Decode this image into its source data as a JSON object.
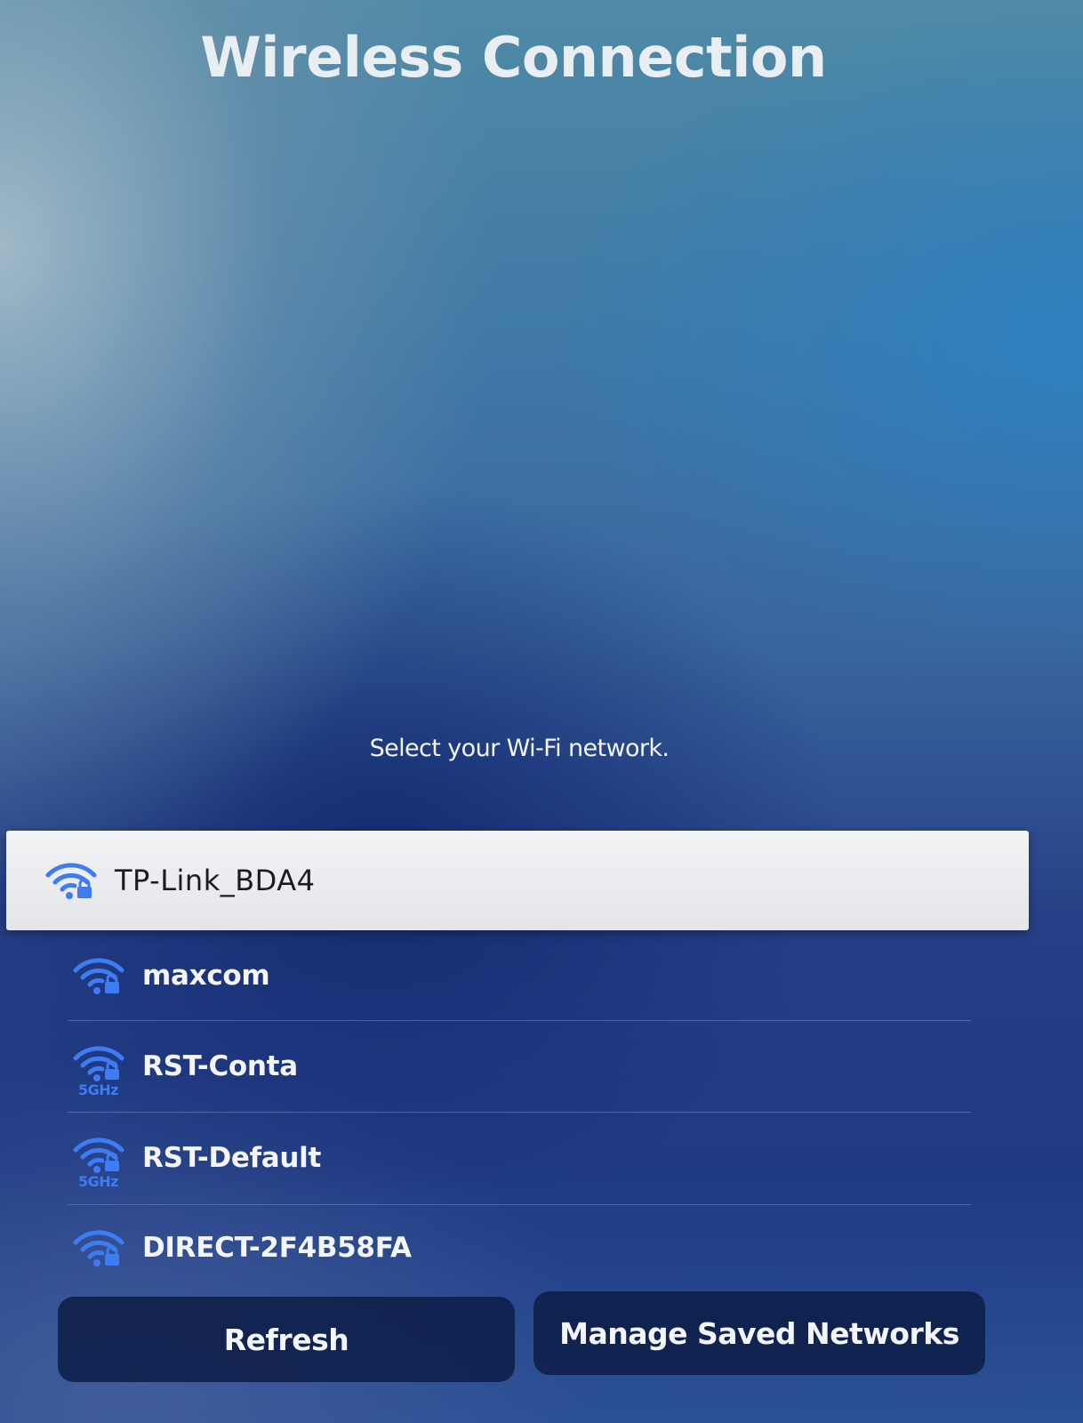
{
  "header": {
    "title": "Wireless Connection"
  },
  "prompt": "Select your Wi-Fi network.",
  "networks": [
    {
      "name": "TP-Link_BDA4",
      "secured": true,
      "band": "",
      "focused": true,
      "icon": "wifi-lock-icon"
    },
    {
      "name": "maxcom",
      "secured": true,
      "band": "",
      "focused": false,
      "icon": "wifi-lock-icon"
    },
    {
      "name": "RST-Conta",
      "secured": true,
      "band": "5GHz",
      "focused": false,
      "icon": "wifi-lock-icon"
    },
    {
      "name": "RST-Default",
      "secured": true,
      "band": "5GHz",
      "focused": false,
      "icon": "wifi-lock-icon"
    },
    {
      "name": "DIRECT-2F4B58FA",
      "secured": true,
      "band": "",
      "focused": false,
      "icon": "wifi-lock-icon"
    }
  ],
  "buttons": {
    "refresh": "Refresh",
    "manage": "Manage Saved Networks"
  },
  "colors": {
    "icon_blue": "#3d7cf2",
    "focus_background": "#eeeff2",
    "button_background": "#0e1e48"
  }
}
